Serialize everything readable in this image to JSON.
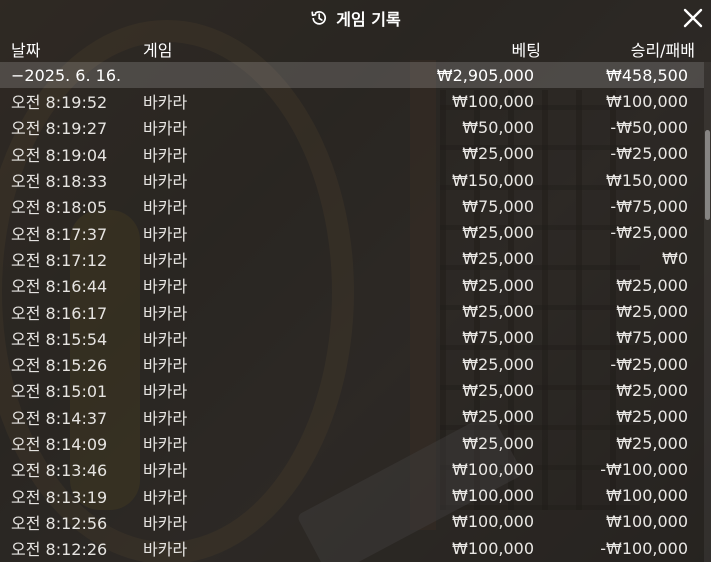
{
  "dialog": {
    "title": "게임 기록",
    "title_icon": "history-icon",
    "close_icon": "close-icon"
  },
  "columns": {
    "time": "날짜",
    "game": "게임",
    "bet": "베팅",
    "result": "승리/패배"
  },
  "summary": {
    "date": "−2025. 6. 16.",
    "bet_total": "₩2,905,000",
    "result_total": "₩458,500"
  },
  "rows": [
    {
      "time": "오전 8:19:52",
      "game": "바카라",
      "bet": "₩100,000",
      "result": "₩100,000"
    },
    {
      "time": "오전 8:19:27",
      "game": "바카라",
      "bet": "₩50,000",
      "result": "-₩50,000"
    },
    {
      "time": "오전 8:19:04",
      "game": "바카라",
      "bet": "₩25,000",
      "result": "-₩25,000"
    },
    {
      "time": "오전 8:18:33",
      "game": "바카라",
      "bet": "₩150,000",
      "result": "₩150,000"
    },
    {
      "time": "오전 8:18:05",
      "game": "바카라",
      "bet": "₩75,000",
      "result": "-₩75,000"
    },
    {
      "time": "오전 8:17:37",
      "game": "바카라",
      "bet": "₩25,000",
      "result": "-₩25,000"
    },
    {
      "time": "오전 8:17:12",
      "game": "바카라",
      "bet": "₩25,000",
      "result": "₩0"
    },
    {
      "time": "오전 8:16:44",
      "game": "바카라",
      "bet": "₩25,000",
      "result": "₩25,000"
    },
    {
      "time": "오전 8:16:17",
      "game": "바카라",
      "bet": "₩25,000",
      "result": "₩25,000"
    },
    {
      "time": "오전 8:15:54",
      "game": "바카라",
      "bet": "₩75,000",
      "result": "₩75,000"
    },
    {
      "time": "오전 8:15:26",
      "game": "바카라",
      "bet": "₩25,000",
      "result": "-₩25,000"
    },
    {
      "time": "오전 8:15:01",
      "game": "바카라",
      "bet": "₩25,000",
      "result": "₩25,000"
    },
    {
      "time": "오전 8:14:37",
      "game": "바카라",
      "bet": "₩25,000",
      "result": "₩25,000"
    },
    {
      "time": "오전 8:14:09",
      "game": "바카라",
      "bet": "₩25,000",
      "result": "₩25,000"
    },
    {
      "time": "오전 8:13:46",
      "game": "바카라",
      "bet": "₩100,000",
      "result": "-₩100,000"
    },
    {
      "time": "오전 8:13:19",
      "game": "바카라",
      "bet": "₩100,000",
      "result": "₩100,000"
    },
    {
      "time": "오전 8:12:56",
      "game": "바카라",
      "bet": "₩100,000",
      "result": "₩100,000"
    },
    {
      "time": "오전 8:12:26",
      "game": "바카라",
      "bet": "₩100,000",
      "result": "-₩100,000"
    }
  ]
}
